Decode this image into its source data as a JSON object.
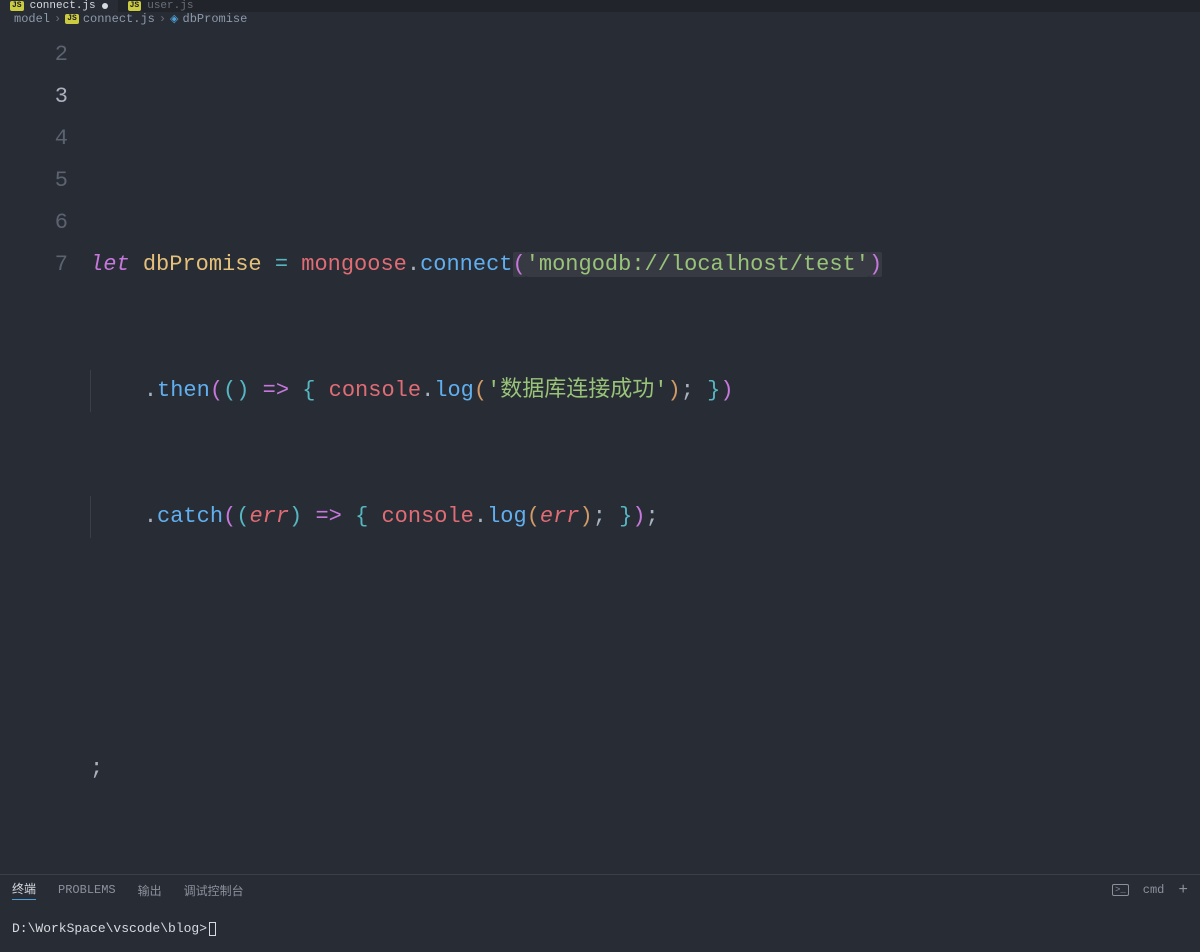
{
  "tabs": [
    {
      "badge": "JS",
      "label": "connect.js",
      "active": true,
      "dirty": true
    },
    {
      "badge": "JS",
      "label": "user.js",
      "active": false,
      "dirty": false
    }
  ],
  "breadcrumb": {
    "seg1": "model",
    "badge": "JS",
    "seg2": "connect.js",
    "symbol": "dbPromise"
  },
  "gutter": [
    "2",
    "3",
    "4",
    "5",
    "6",
    "7"
  ],
  "code": {
    "line3": {
      "kw": "let",
      "var": "dbPromise",
      "eq": "=",
      "obj": "mongoose",
      "fn": "connect",
      "str": "'mongodb://localhost/test'"
    },
    "line4": {
      "fn": "then",
      "obj": "console",
      "log": "log",
      "str": "'数据库连接成功'"
    },
    "line5": {
      "fn": "catch",
      "param": "err",
      "obj": "console",
      "log": "log",
      "arg": "err"
    },
    "line7": ";"
  },
  "panel": {
    "tabs": {
      "terminal": "终端",
      "problems": "PROBLEMS",
      "output": "输出",
      "debug": "调试控制台"
    },
    "right": {
      "icon": ">_",
      "shell": "cmd",
      "plus": "+"
    }
  },
  "terminal": {
    "prompt": "D:\\WorkSpace\\vscode\\blog>"
  }
}
